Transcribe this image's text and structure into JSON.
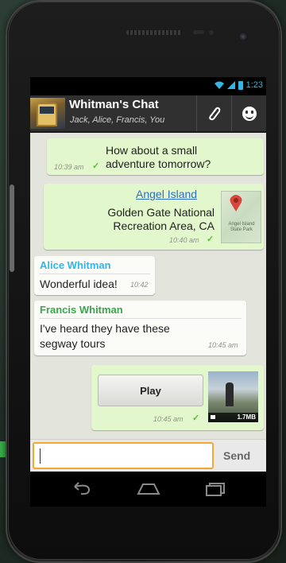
{
  "status": {
    "time": "1:23"
  },
  "chat": {
    "title": "Whitman's Chat",
    "participants": "Jack, Alice, Francis, You"
  },
  "messages": [
    {
      "type": "outgoing",
      "text_line1": "How about a small",
      "text_line2": "adventure tomorrow?",
      "time": "10:39 am",
      "check": "✓"
    },
    {
      "type": "outgoing-location",
      "place": "Angel Island",
      "address_line1": "Golden Gate National",
      "address_line2": "Recreation Area, CA",
      "map_label": "Angel Island State Park",
      "time": "10:40 am",
      "check": "✓"
    },
    {
      "type": "incoming",
      "sender": "Alice Whitman",
      "sender_color": "#33b5e5",
      "text": "Wonderful idea!",
      "time": "10:42"
    },
    {
      "type": "incoming",
      "sender": "Francis Whitman",
      "sender_color": "#39a84b",
      "text_line1": "I've heard they have these",
      "text_line2": "segway tours",
      "time": "10:45 am"
    },
    {
      "type": "outgoing-video",
      "button_label": "Play",
      "file_size": "1.7MB",
      "time": "10:45 am",
      "check": "✓"
    }
  ],
  "input": {
    "placeholder": "",
    "send_label": "Send"
  },
  "icons": {
    "attach": "paperclip-icon",
    "emoji": "smiley-icon",
    "back": "back-icon",
    "home": "home-icon",
    "recents": "recents-icon"
  },
  "colors": {
    "accent_orange": "#f5a733",
    "outgoing_bubble": "#e2f7cb",
    "actionbar": "#303030"
  }
}
